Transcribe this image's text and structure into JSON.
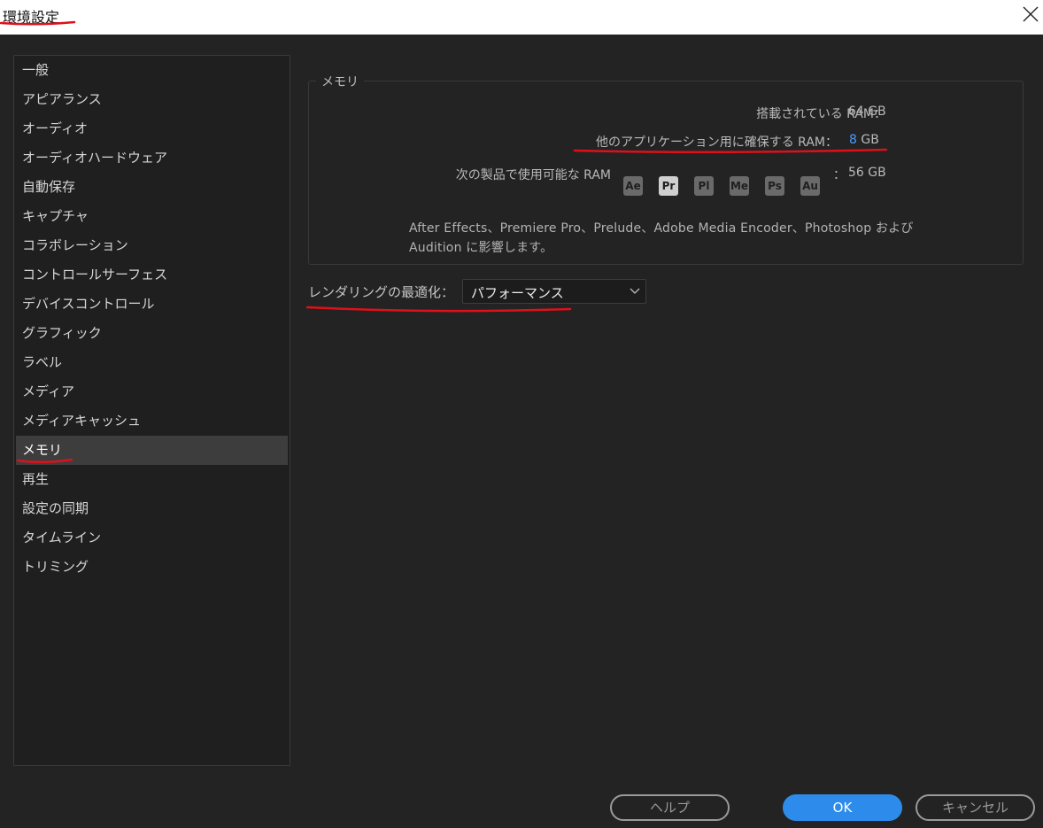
{
  "window": {
    "title": "環境設定"
  },
  "sidebar": {
    "items": [
      {
        "label": "一般"
      },
      {
        "label": "アピアランス"
      },
      {
        "label": "オーディオ"
      },
      {
        "label": "オーディオハードウェア"
      },
      {
        "label": "自動保存"
      },
      {
        "label": "キャプチャ"
      },
      {
        "label": "コラボレーション"
      },
      {
        "label": "コントロールサーフェス"
      },
      {
        "label": "デバイスコントロール"
      },
      {
        "label": "グラフィック"
      },
      {
        "label": "ラベル"
      },
      {
        "label": "メディア"
      },
      {
        "label": "メディアキャッシュ"
      },
      {
        "label": "メモリ",
        "selected": true
      },
      {
        "label": "再生"
      },
      {
        "label": "設定の同期"
      },
      {
        "label": "タイムライン"
      },
      {
        "label": "トリミング"
      }
    ]
  },
  "memory": {
    "group_title": "メモリ",
    "installed_label": "搭載されている RAM：",
    "installed_value": "64 GB",
    "reserved_label": "他のアプリケーション用に確保する RAM：",
    "reserved_value": "8",
    "reserved_unit": "GB",
    "available_label": "次の製品で使用可能な RAM",
    "available_sep": "：",
    "available_value": "56 GB",
    "apps": [
      {
        "code": "Ae",
        "active": false
      },
      {
        "code": "Pr",
        "active": true
      },
      {
        "code": "Pl",
        "active": false
      },
      {
        "code": "Me",
        "active": false
      },
      {
        "code": "Ps",
        "active": false
      },
      {
        "code": "Au",
        "active": false
      }
    ],
    "description_line1": "After Effects、Premiere Pro、Prelude、Adobe Media Encoder、Photoshop および",
    "description_line2": "Audition に影響します。"
  },
  "rendering": {
    "label": "レンダリングの最適化：",
    "selected": "パフォーマンス"
  },
  "buttons": {
    "help": "ヘルプ",
    "ok": "OK",
    "cancel": "キャンセル"
  },
  "colors": {
    "accent": "#2d8ceb",
    "value_highlight": "#4a9cff",
    "annotation": "#e0101a"
  }
}
